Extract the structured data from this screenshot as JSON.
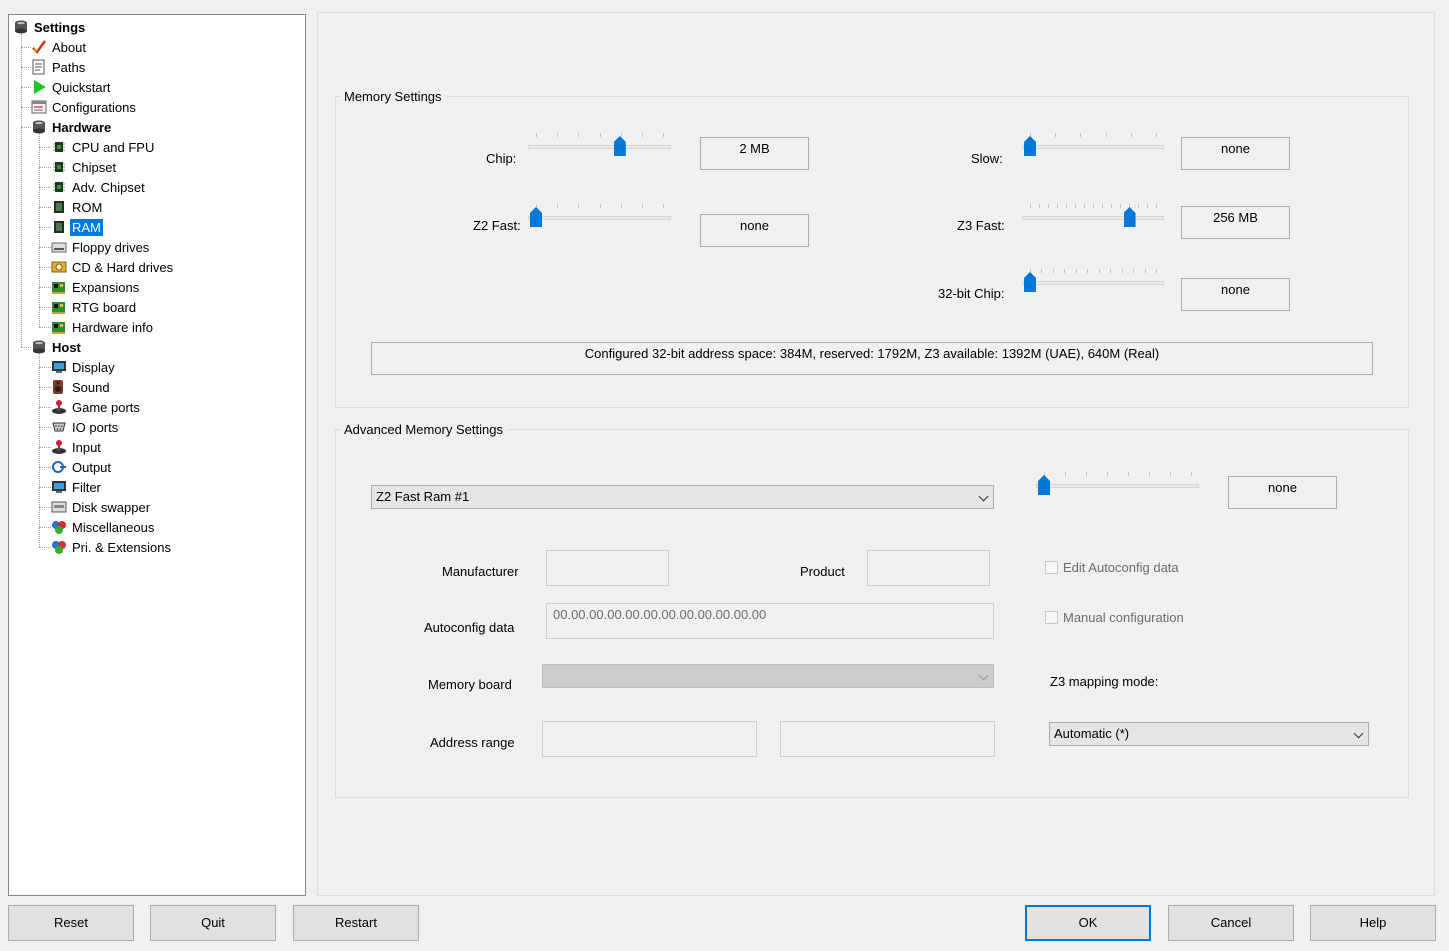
{
  "tree": {
    "items": [
      {
        "label": "Settings",
        "bold": true,
        "level": 0,
        "icon": "settings-icon"
      },
      {
        "label": "About",
        "bold": false,
        "level": 1,
        "icon": "checkmark-icon"
      },
      {
        "label": "Paths",
        "bold": false,
        "level": 1,
        "icon": "paths-icon"
      },
      {
        "label": "Quickstart",
        "bold": false,
        "level": 1,
        "icon": "play-icon"
      },
      {
        "label": "Configurations",
        "bold": false,
        "level": 1,
        "icon": "configurations-icon"
      },
      {
        "label": "Hardware",
        "bold": true,
        "level": 1,
        "icon": "hardware-icon"
      },
      {
        "label": "CPU and FPU",
        "bold": false,
        "level": 2,
        "icon": "chip-icon"
      },
      {
        "label": "Chipset",
        "bold": false,
        "level": 2,
        "icon": "chip-icon"
      },
      {
        "label": "Adv. Chipset",
        "bold": false,
        "level": 2,
        "icon": "chip-icon"
      },
      {
        "label": "ROM",
        "bold": false,
        "level": 2,
        "icon": "rom-icon"
      },
      {
        "label": "RAM",
        "bold": false,
        "level": 2,
        "icon": "ram-icon",
        "selected": true
      },
      {
        "label": "Floppy drives",
        "bold": false,
        "level": 2,
        "icon": "floppy-icon"
      },
      {
        "label": "CD & Hard drives",
        "bold": false,
        "level": 2,
        "icon": "hard-drive-icon"
      },
      {
        "label": "Expansions",
        "bold": false,
        "level": 2,
        "icon": "expansion-board-icon"
      },
      {
        "label": "RTG board",
        "bold": false,
        "level": 2,
        "icon": "expansion-board-icon"
      },
      {
        "label": "Hardware info",
        "bold": false,
        "level": 2,
        "icon": "expansion-board-icon"
      },
      {
        "label": "Host",
        "bold": true,
        "level": 1,
        "icon": "host-icon"
      },
      {
        "label": "Display",
        "bold": false,
        "level": 2,
        "icon": "monitor-icon"
      },
      {
        "label": "Sound",
        "bold": false,
        "level": 2,
        "icon": "speaker-icon"
      },
      {
        "label": "Game ports",
        "bold": false,
        "level": 2,
        "icon": "joystick-icon"
      },
      {
        "label": "IO ports",
        "bold": false,
        "level": 2,
        "icon": "io-port-icon"
      },
      {
        "label": "Input",
        "bold": false,
        "level": 2,
        "icon": "joystick-icon"
      },
      {
        "label": "Output",
        "bold": false,
        "level": 2,
        "icon": "output-icon"
      },
      {
        "label": "Filter",
        "bold": false,
        "level": 2,
        "icon": "monitor-icon"
      },
      {
        "label": "Disk swapper",
        "bold": false,
        "level": 2,
        "icon": "disk-swapper-icon"
      },
      {
        "label": "Miscellaneous",
        "bold": false,
        "level": 2,
        "icon": "misc-icon"
      },
      {
        "label": "Pri. & Extensions",
        "bold": false,
        "level": 2,
        "icon": "misc-icon"
      }
    ]
  },
  "memory": {
    "title": "Memory Settings",
    "chip": {
      "label": "Chip:",
      "value": "2 MB",
      "level": 0.66,
      "ticks": 7
    },
    "slow": {
      "label": "Slow:",
      "value": "none",
      "level": 0.0,
      "ticks": 6
    },
    "z2fast": {
      "label": "Z2 Fast:",
      "value": "none",
      "level": 0.0,
      "ticks": 7
    },
    "z3fast": {
      "label": "Z3 Fast:",
      "value": "256 MB",
      "level": 0.79,
      "ticks": 15
    },
    "chip32": {
      "label": "32-bit Chip:",
      "value": "none",
      "level": 0.0,
      "ticks": 12
    },
    "info": "Configured 32-bit address space: 384M, reserved: 1792M, Z3 available: 1392M (UAE), 640M (Real)"
  },
  "advanced": {
    "title": "Advanced Memory Settings",
    "board_select": "Z2 Fast Ram #1",
    "slider": {
      "value": "none",
      "level": 0.0,
      "ticks": 8
    },
    "manufacturer_label": "Manufacturer",
    "manufacturer_value": "",
    "product_label": "Product",
    "product_value": "",
    "edit_autoconfig_label": "Edit Autoconfig data",
    "edit_autoconfig_checked": false,
    "autoconfig_label": "Autoconfig data",
    "autoconfig_value": "00.00.00.00.00.00.00.00.00.00.00.00",
    "manual_config_label": "Manual configuration",
    "manual_config_checked": false,
    "memory_board_label": "Memory board",
    "memory_board_value": "",
    "z3_mapping_label": "Z3 mapping mode:",
    "z3_mapping_value": "Automatic (*)",
    "address_range_label": "Address range",
    "address_start": "",
    "address_end": ""
  },
  "buttons": {
    "reset": "Reset",
    "quit": "Quit",
    "restart": "Restart",
    "ok": "OK",
    "cancel": "Cancel",
    "help": "Help"
  },
  "colors": {
    "accent": "#0078d7",
    "selection": "#0078d7"
  }
}
